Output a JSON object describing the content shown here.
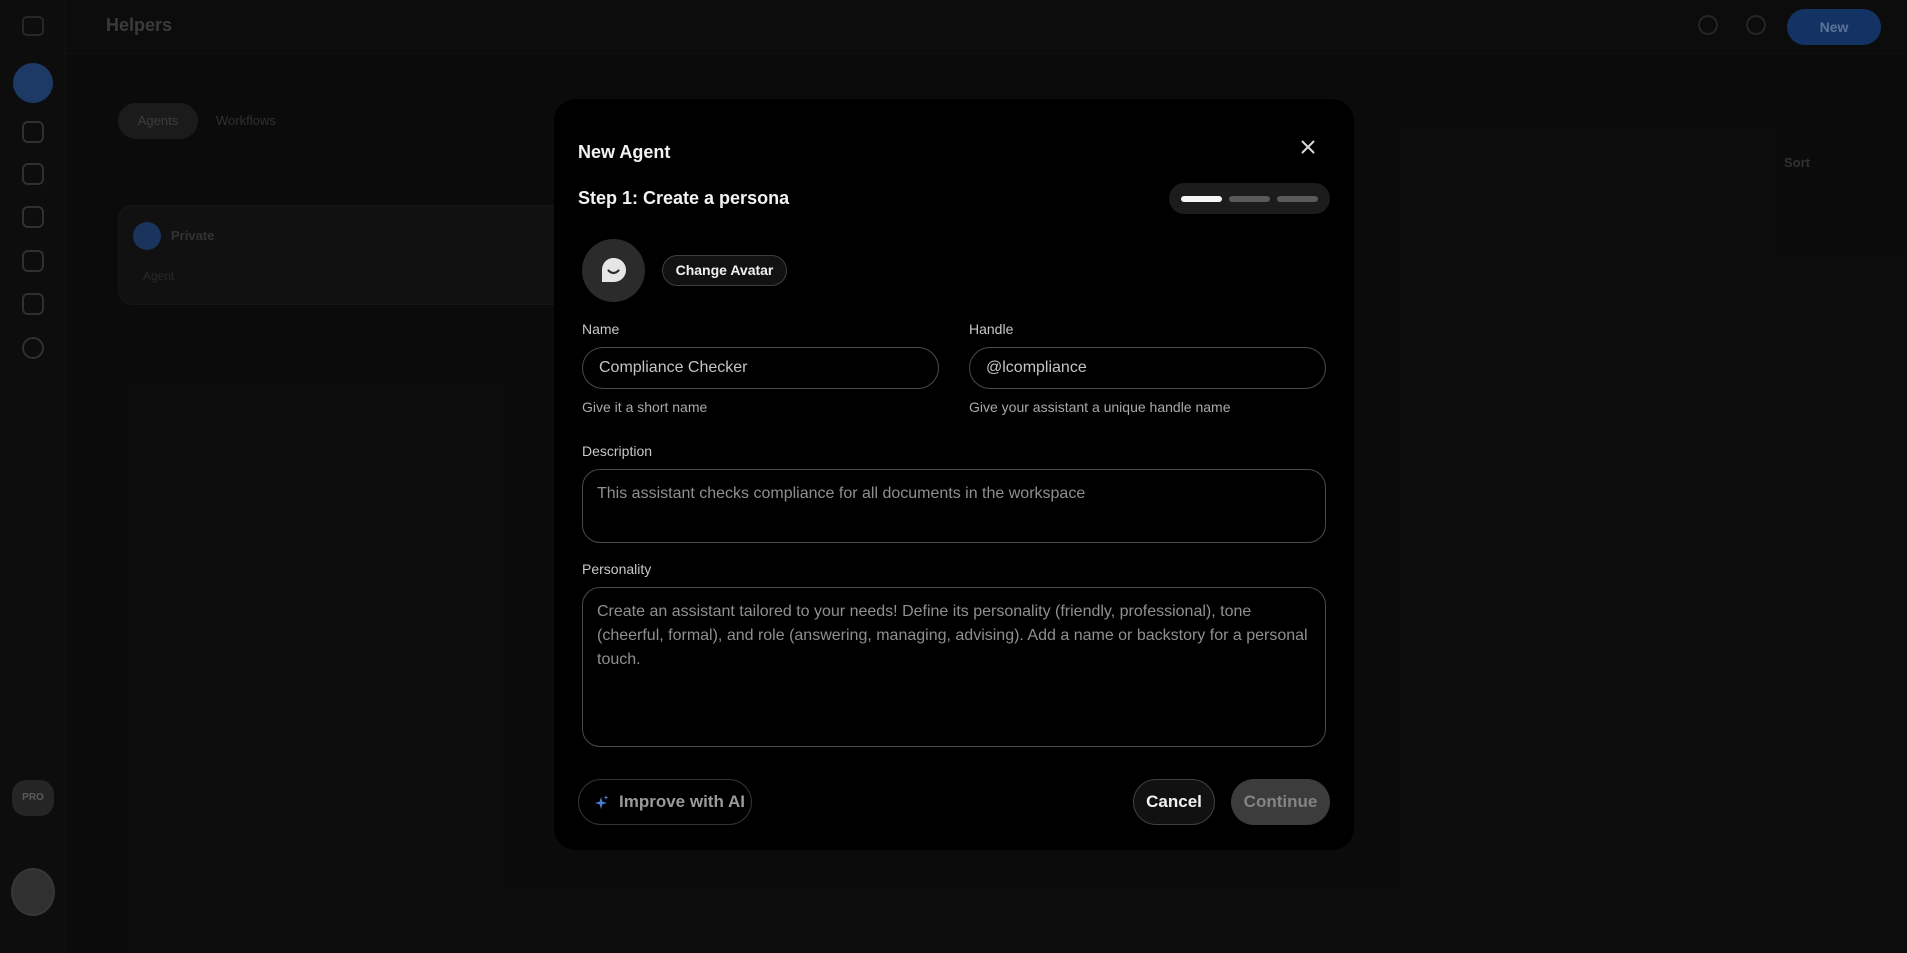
{
  "app": {
    "page_title": "Helpers",
    "new_button_label": "New",
    "tabs": [
      {
        "label": "Agents",
        "active": true
      },
      {
        "label": "Workflows",
        "active": false
      }
    ],
    "sort_label": "Sort",
    "card": {
      "title": "Private",
      "subtitle": "Agent"
    },
    "sidebar_badge": "PRO"
  },
  "modal": {
    "title": "New Agent",
    "step_title": "Step 1: Create a persona",
    "steps_total": 3,
    "current_step": 1,
    "change_avatar_label": "Change Avatar",
    "name": {
      "label": "Name",
      "value": "Compliance Checker",
      "helper": "Give it a short name"
    },
    "handle": {
      "label": "Handle",
      "value": "@lcompliance",
      "helper": "Give your assistant a unique handle name"
    },
    "description": {
      "label": "Description",
      "placeholder": "This assistant checks compliance for all documents in the workspace"
    },
    "personality": {
      "label": "Personality",
      "placeholder": "Create an assistant tailored to your needs! Define its personality (friendly, professional), tone (cheerful, formal), and role (answering, managing, advising). Add a name or backstory for a personal touch."
    },
    "improve_label": "Improve with AI",
    "cancel_label": "Cancel",
    "continue_label": "Continue"
  },
  "colors": {
    "background": "#121212",
    "modal": "#000000",
    "accent": "#1f4f9c",
    "input_border": "#4a4a4a"
  }
}
